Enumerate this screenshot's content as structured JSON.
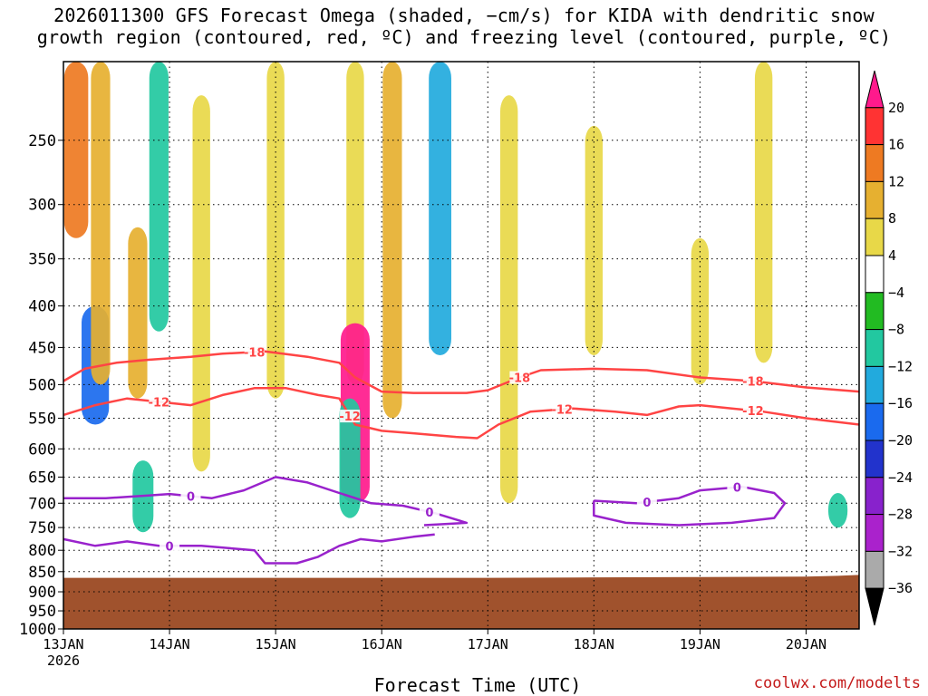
{
  "header": {
    "title_line1": "2026011300 GFS Forecast Omega (shaded, −cm/s) for KIDA with dendritic snow",
    "title_line2": "growth region (contoured, red, ºC) and freezing level (contoured, purple, ºC)"
  },
  "footer": {
    "xlabel": "Forecast Time (UTC)",
    "credit": "coolwx.com/modelts"
  },
  "chart_data": {
    "type": "heatmap",
    "title": "2026011300 GFS Forecast Omega (shaded, −cm/s) for KIDA with dendritic snow growth region (contoured, red, ºC) and freezing level (contoured, purple, ºC)",
    "xlabel": "Forecast Time (UTC)",
    "ylabel": "",
    "x_range": [
      "2026-01-13T00",
      "2026-01-20T12"
    ],
    "x_ticks": [
      "13JAN",
      "14JAN",
      "15JAN",
      "16JAN",
      "17JAN",
      "18JAN",
      "19JAN",
      "20JAN"
    ],
    "x_tick_year": "2026",
    "y_scale": "log-pressure",
    "y_range": [
      1000,
      200
    ],
    "y_ticks": [
      250,
      300,
      350,
      400,
      450,
      500,
      550,
      600,
      650,
      700,
      750,
      800,
      850,
      900,
      950,
      1000
    ],
    "colorbar": {
      "labels": [
        "20",
        "16",
        "12",
        "8",
        "4",
        "−4",
        "−8",
        "−12",
        "−16",
        "−20",
        "−24",
        "−28",
        "−32",
        "−36"
      ],
      "colors": [
        "#ff1a8c",
        "#ff3333",
        "#ee7a22",
        "#e6b030",
        "#e8d848",
        "#ffffff",
        "#22bb22",
        "#22c8a0",
        "#22aadd",
        "#1a6aee",
        "#2233cc",
        "#8822cc",
        "#aa22cc",
        "#aaaaaa",
        "#000000"
      ]
    },
    "terrain_color": "#a0522d",
    "terrain_top_hpa": [
      865,
      865,
      865,
      865,
      865,
      864,
      863,
      862,
      860,
      858
    ],
    "terrain_top_x": [
      0,
      1,
      2,
      3,
      4,
      5,
      6,
      7,
      7.3,
      7.5
    ],
    "omega_regions": [
      {
        "t": 0.12,
        "p_top": 200,
        "p_bot": 330,
        "value": 14
      },
      {
        "t": 0.3,
        "p_top": 400,
        "p_bot": 560,
        "value": -18
      },
      {
        "t": 0.35,
        "p_top": 200,
        "p_bot": 500,
        "value": 8
      },
      {
        "t": 0.7,
        "p_top": 320,
        "p_bot": 520,
        "value": 8
      },
      {
        "t": 0.75,
        "p_top": 620,
        "p_bot": 760,
        "value": -10
      },
      {
        "t": 0.9,
        "p_top": 200,
        "p_bot": 430,
        "value": -8
      },
      {
        "t": 1.3,
        "p_top": 220,
        "p_bot": 640,
        "value": 6
      },
      {
        "t": 2.0,
        "p_top": 200,
        "p_bot": 520,
        "value": 6
      },
      {
        "t": 2.75,
        "p_top": 200,
        "p_bot": 500,
        "value": 6
      },
      {
        "t": 2.75,
        "p_top": 420,
        "p_bot": 700,
        "value": 20
      },
      {
        "t": 2.7,
        "p_top": 520,
        "p_bot": 730,
        "value": -10
      },
      {
        "t": 3.1,
        "p_top": 200,
        "p_bot": 550,
        "value": 8
      },
      {
        "t": 3.55,
        "p_top": 200,
        "p_bot": 460,
        "value": -12
      },
      {
        "t": 4.2,
        "p_top": 220,
        "p_bot": 700,
        "value": 6
      },
      {
        "t": 5.0,
        "p_top": 240,
        "p_bot": 460,
        "value": 6
      },
      {
        "t": 6.0,
        "p_top": 330,
        "p_bot": 500,
        "value": 6
      },
      {
        "t": 6.6,
        "p_top": 200,
        "p_bot": 470,
        "value": 6
      },
      {
        "t": 7.3,
        "p_top": 680,
        "p_bot": 750,
        "value": -8
      }
    ],
    "contours": [
      {
        "label": "-18",
        "color": "#ff4444",
        "points": [
          [
            0,
            495
          ],
          [
            0.2,
            478
          ],
          [
            0.5,
            470
          ],
          [
            0.8,
            466
          ],
          [
            1.2,
            462
          ],
          [
            1.5,
            458
          ],
          [
            1.9,
            455
          ],
          [
            2.3,
            462
          ],
          [
            2.6,
            470
          ],
          [
            2.75,
            490
          ],
          [
            3.0,
            510
          ],
          [
            3.3,
            512
          ],
          [
            3.8,
            512
          ],
          [
            4.0,
            508
          ],
          [
            4.3,
            490
          ],
          [
            4.5,
            480
          ],
          [
            5.0,
            478
          ],
          [
            5.5,
            480
          ],
          [
            6.0,
            490
          ],
          [
            6.5,
            495
          ],
          [
            7.0,
            504
          ],
          [
            7.5,
            510
          ]
        ],
        "labels_at": [
          1.8,
          4.3,
          6.5
        ]
      },
      {
        "label": "-12",
        "color": "#ff4444",
        "points": [
          [
            0,
            545
          ],
          [
            0.3,
            530
          ],
          [
            0.6,
            520
          ],
          [
            0.9,
            525
          ],
          [
            1.2,
            530
          ],
          [
            1.5,
            515
          ],
          [
            1.8,
            505
          ],
          [
            2.1,
            505
          ],
          [
            2.4,
            515
          ],
          [
            2.6,
            520
          ],
          [
            2.75,
            560
          ],
          [
            3.0,
            570
          ],
          [
            3.3,
            574
          ],
          [
            3.7,
            580
          ],
          [
            3.9,
            582
          ],
          [
            4.1,
            560
          ],
          [
            4.4,
            540
          ],
          [
            4.8,
            535
          ],
          [
            5.2,
            540
          ],
          [
            5.5,
            545
          ],
          [
            5.8,
            532
          ],
          [
            6.0,
            530
          ],
          [
            6.3,
            535
          ],
          [
            6.6,
            540
          ],
          [
            7.0,
            550
          ],
          [
            7.5,
            560
          ]
        ],
        "labels_at": [
          0.9,
          2.7,
          4.7,
          6.5
        ]
      },
      {
        "label": "0",
        "color": "#9922cc",
        "points": [
          [
            0,
            690
          ],
          [
            0.4,
            690
          ],
          [
            0.8,
            685
          ],
          [
            1.0,
            682
          ],
          [
            1.4,
            690
          ],
          [
            1.7,
            675
          ],
          [
            2.0,
            650
          ],
          [
            2.3,
            660
          ],
          [
            2.6,
            680
          ],
          [
            2.9,
            700
          ],
          [
            3.2,
            705
          ],
          [
            3.5,
            720
          ],
          [
            3.8,
            740
          ],
          [
            3.4,
            745
          ]
        ],
        "labels_at": [
          1.2,
          3.45
        ]
      },
      {
        "label": "0",
        "color": "#9922cc",
        "points": [
          [
            5.0,
            695
          ],
          [
            5.4,
            700
          ],
          [
            5.8,
            690
          ],
          [
            6.0,
            675
          ],
          [
            6.4,
            668
          ],
          [
            6.7,
            680
          ],
          [
            6.8,
            700
          ],
          [
            6.7,
            730
          ],
          [
            6.3,
            740
          ],
          [
            5.8,
            745
          ],
          [
            5.3,
            740
          ],
          [
            5.0,
            725
          ],
          [
            5.0,
            695
          ]
        ],
        "labels_at": [
          5.5,
          6.35
        ]
      },
      {
        "label": "0",
        "color": "#9922cc",
        "points": [
          [
            0,
            775
          ],
          [
            0.3,
            790
          ],
          [
            0.6,
            780
          ],
          [
            0.9,
            790
          ],
          [
            1.3,
            790
          ],
          [
            1.8,
            800
          ],
          [
            1.9,
            830
          ],
          [
            2.2,
            830
          ],
          [
            2.4,
            815
          ],
          [
            2.6,
            790
          ],
          [
            2.8,
            775
          ],
          [
            3.0,
            780
          ],
          [
            3.3,
            770
          ],
          [
            3.5,
            765
          ]
        ],
        "labels_at": [
          1.0
        ]
      }
    ]
  }
}
